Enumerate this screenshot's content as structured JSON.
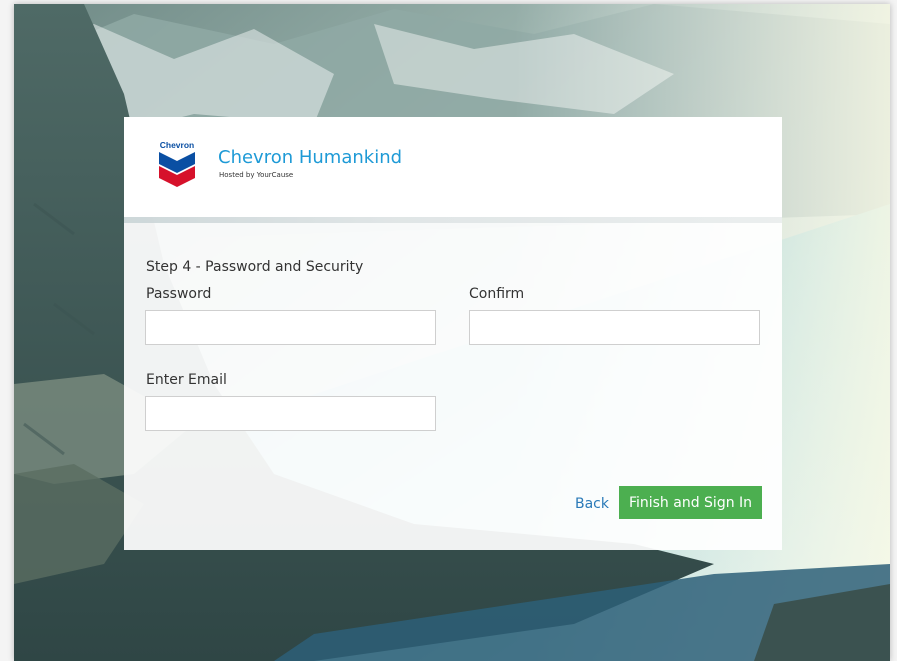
{
  "brand": {
    "logo_text": "Chevron",
    "title": "Chevron Humankind",
    "subtitle": "Hosted by YourCause"
  },
  "form": {
    "step_title": "Step 4 - Password and Security",
    "password_label": "Password",
    "password_value": "",
    "confirm_label": "Confirm",
    "confirm_value": "",
    "email_label": "Enter Email",
    "email_value": ""
  },
  "actions": {
    "back_label": "Back",
    "finish_label": "Finish and Sign In"
  },
  "colors": {
    "brand_blue": "#1e9ad6",
    "link_blue": "#2a7ab8",
    "primary_green": "#4caf50",
    "chevron_blue": "#0a4fa3",
    "chevron_red": "#d6112b"
  }
}
